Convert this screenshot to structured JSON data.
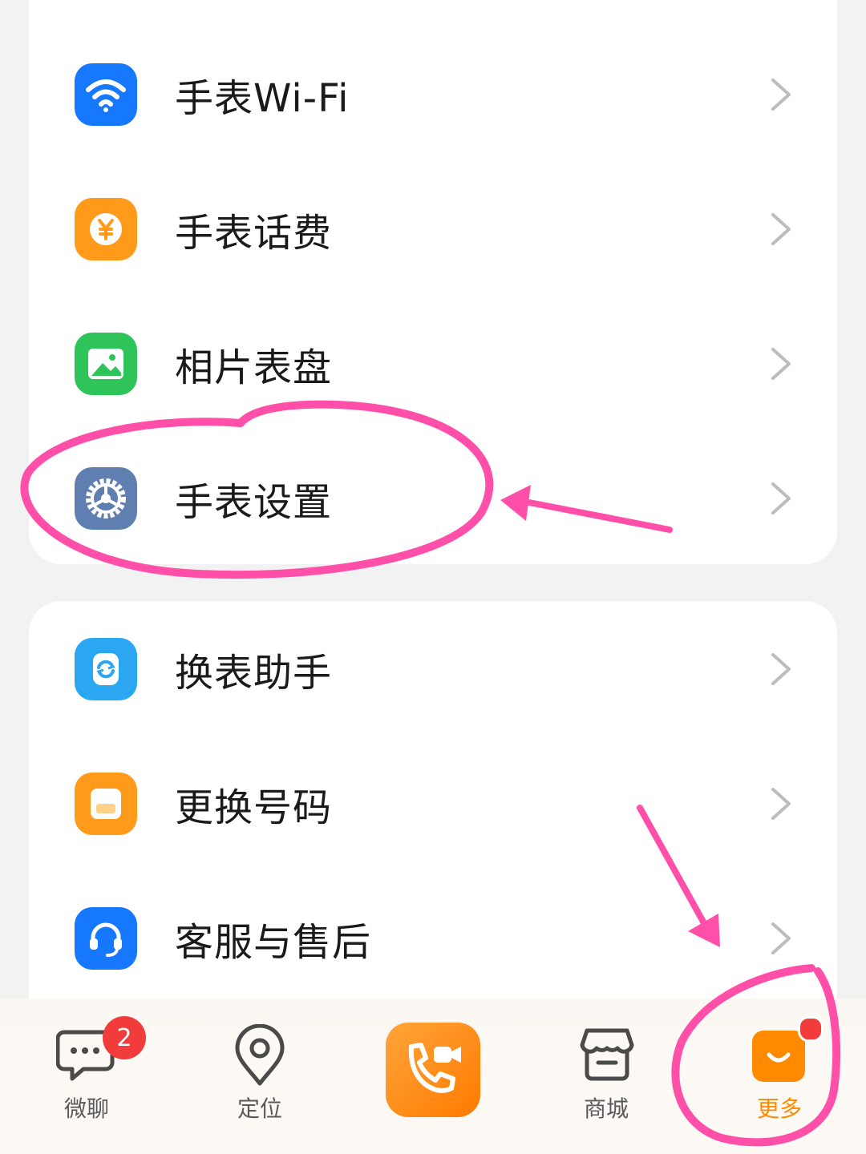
{
  "menu": {
    "items": [
      {
        "label": "手表Wi-Fi",
        "icon": "wifi-icon",
        "color": "#1677ff"
      },
      {
        "label": "手表话费",
        "icon": "yuan-coin-icon",
        "color": "#ff9a1a"
      },
      {
        "label": "相片表盘",
        "icon": "picture-icon",
        "color": "#2ec45a"
      },
      {
        "label": "手表设置",
        "icon": "gear-icon",
        "color": "#5f7fb0"
      },
      {
        "label": "换表助手",
        "icon": "watch-swap-icon",
        "color": "#2aa7f0"
      },
      {
        "label": "更换号码",
        "icon": "sim-card-icon",
        "color": "#ff9a1a"
      },
      {
        "label": "客服与售后",
        "icon": "headset-icon",
        "color": "#1677ff"
      }
    ]
  },
  "nav": {
    "chat_label": "微聊",
    "chat_badge": "2",
    "location_label": "定位",
    "shop_label": "商城",
    "more_label": "更多",
    "accent_color": "#ff8a00"
  }
}
